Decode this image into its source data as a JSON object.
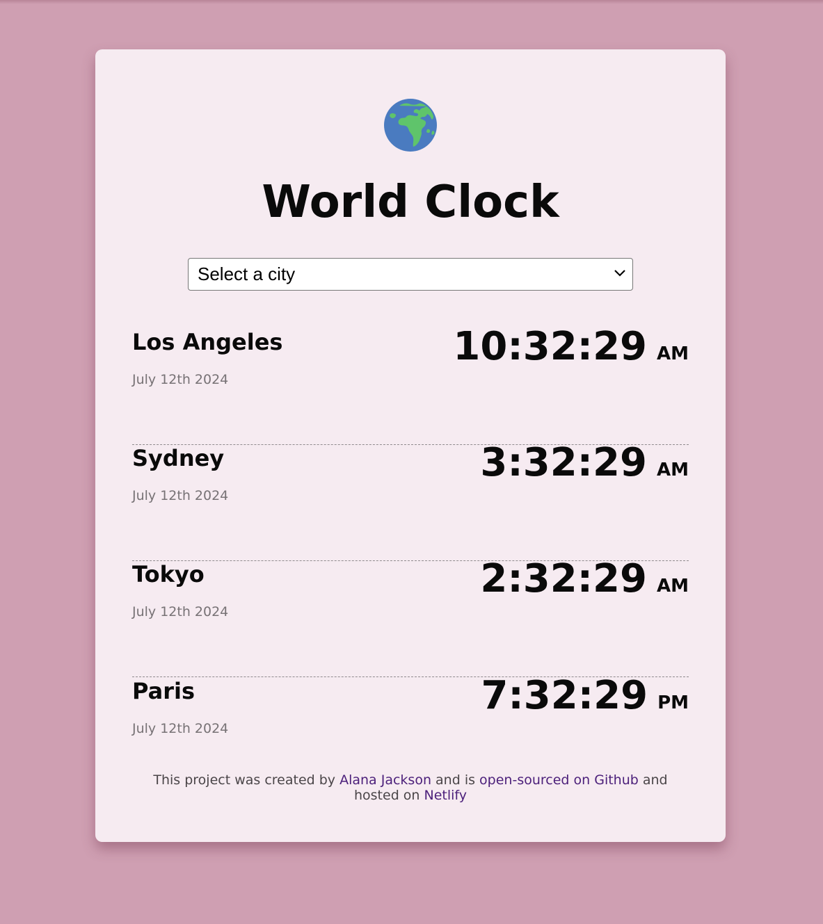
{
  "app": {
    "title": "World Clock",
    "icon": "globe-europe-africa-icon"
  },
  "city_select": {
    "selected_label": "Select a city",
    "icon": "chevron-down-icon"
  },
  "cities": [
    {
      "name": "Los Angeles",
      "date": "July 12th 2024",
      "time": "10:32:29",
      "period": "AM"
    },
    {
      "name": "Sydney",
      "date": "July 12th 2024",
      "time": "3:32:29",
      "period": "AM"
    },
    {
      "name": "Tokyo",
      "date": "July 12th 2024",
      "time": "2:32:29",
      "period": "AM"
    },
    {
      "name": "Paris",
      "date": "July 12th 2024",
      "time": "7:32:29",
      "period": "PM"
    }
  ],
  "footer": {
    "text_1": "This project was created by ",
    "author_link": "Alana Jackson",
    "text_2": " and is ",
    "github_link": "open-sourced on Github",
    "text_3": " and hosted on ",
    "netlify_link": "Netlify"
  },
  "colors": {
    "page_background": "#cf9fb2",
    "card_background": "#f6ebf1",
    "link": "#4b1f7a"
  }
}
